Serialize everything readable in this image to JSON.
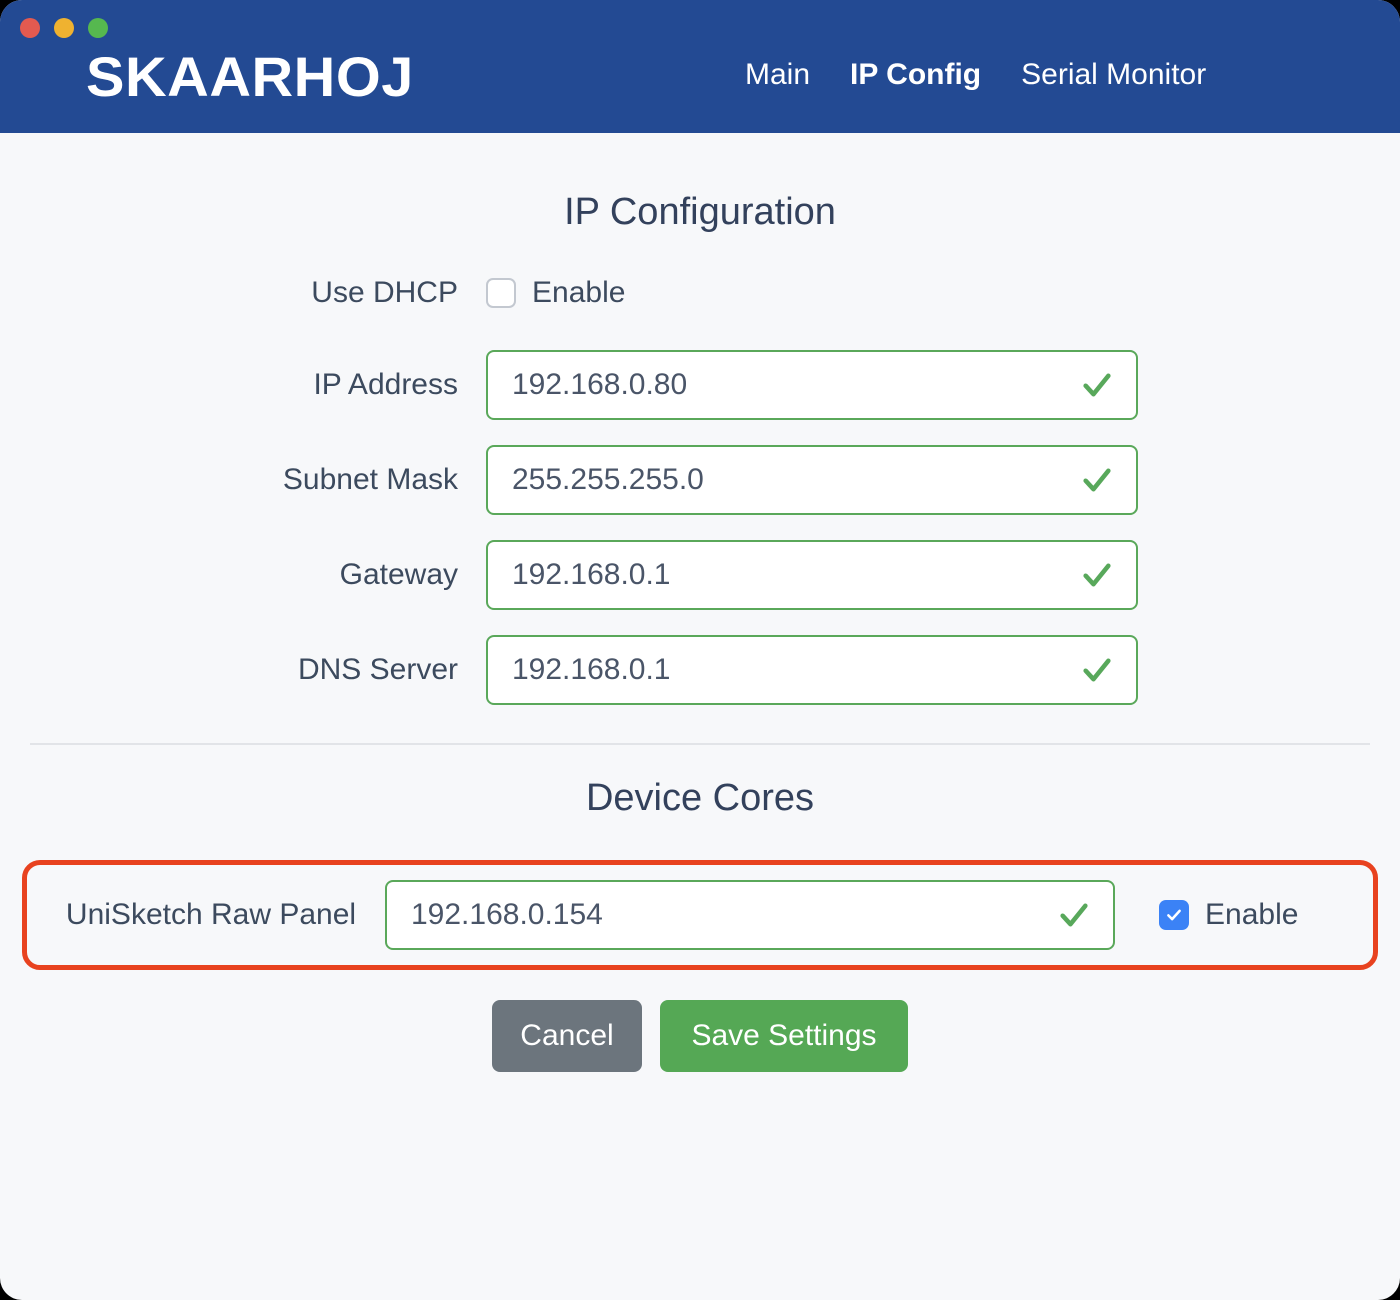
{
  "window": {
    "traffic_lights": [
      {
        "name": "close",
        "color": "#e35a50"
      },
      {
        "name": "minimize",
        "color": "#efb230"
      },
      {
        "name": "maximize",
        "color": "#56b84f"
      }
    ],
    "header_color": "#234a93",
    "background_color": "#f7f8fa"
  },
  "header": {
    "brand": "SKAARHOJ",
    "nav": [
      {
        "label": "Main",
        "active": false
      },
      {
        "label": "IP Config",
        "active": true
      },
      {
        "label": "Serial Monitor",
        "active": false
      }
    ]
  },
  "ip_config": {
    "title": "IP Configuration",
    "dhcp": {
      "label": "Use DHCP",
      "checkbox_label": "Enable",
      "checked": false
    },
    "fields": [
      {
        "label": "IP Address",
        "value": "192.168.0.80",
        "valid": true
      },
      {
        "label": "Subnet Mask",
        "value": "255.255.255.0",
        "valid": true
      },
      {
        "label": "Gateway",
        "value": "192.168.0.1",
        "valid": true
      },
      {
        "label": "DNS Server",
        "value": "192.168.0.1",
        "valid": true
      }
    ]
  },
  "device_cores": {
    "title": "Device Cores",
    "highlight_color": "#e8421f",
    "core": {
      "label": "UniSketch Raw Panel",
      "value": "192.168.0.154",
      "valid": true,
      "checkbox_label": "Enable",
      "checked": true
    }
  },
  "actions": {
    "cancel_label": "Cancel",
    "save_label": "Save Settings",
    "cancel_color": "#6c757d",
    "save_color": "#55a855"
  },
  "icons": {
    "valid_check": "check-icon",
    "checkbox_check": "checkmark-icon"
  }
}
